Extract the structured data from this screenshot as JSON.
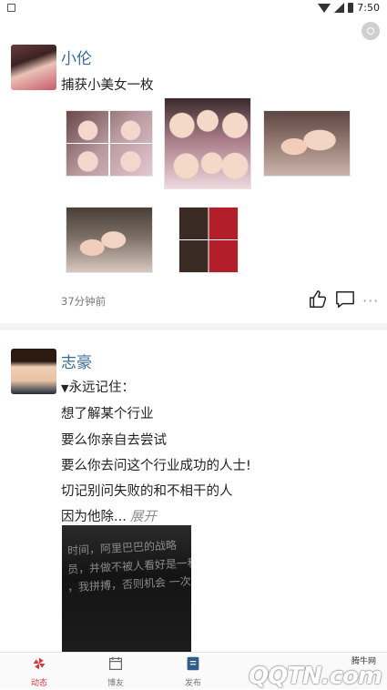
{
  "status_bar": {
    "time": "7:50"
  },
  "feed": {
    "posts": [
      {
        "username": "小伦",
        "text": "捕获小美女一枚",
        "time": "37分钟前"
      },
      {
        "username": "志豪",
        "lines": [
          "永远记住：",
          "想了解某个行业",
          "要么你亲自去尝试",
          "要么你去问这个行业成功的人士!",
          "切记别问失败的和不相干的人",
          "因为他除..."
        ],
        "expand_label": "展开",
        "image_text_lines": [
          "时间，阿里巴巴的战略",
          "员，并做不被人看好是一种",
          "，我拼搏，否则机会 一次"
        ]
      }
    ]
  },
  "tabbar": {
    "tabs": [
      {
        "label": "动态",
        "active": true
      },
      {
        "label": "博友",
        "active": false
      },
      {
        "label": "发布",
        "active": false
      }
    ]
  },
  "watermark": {
    "brand_text": "腾牛网",
    "logo_text": "QQTN.com"
  },
  "colors": {
    "username": "#3b6a96",
    "active_tab": "#d9363e"
  }
}
